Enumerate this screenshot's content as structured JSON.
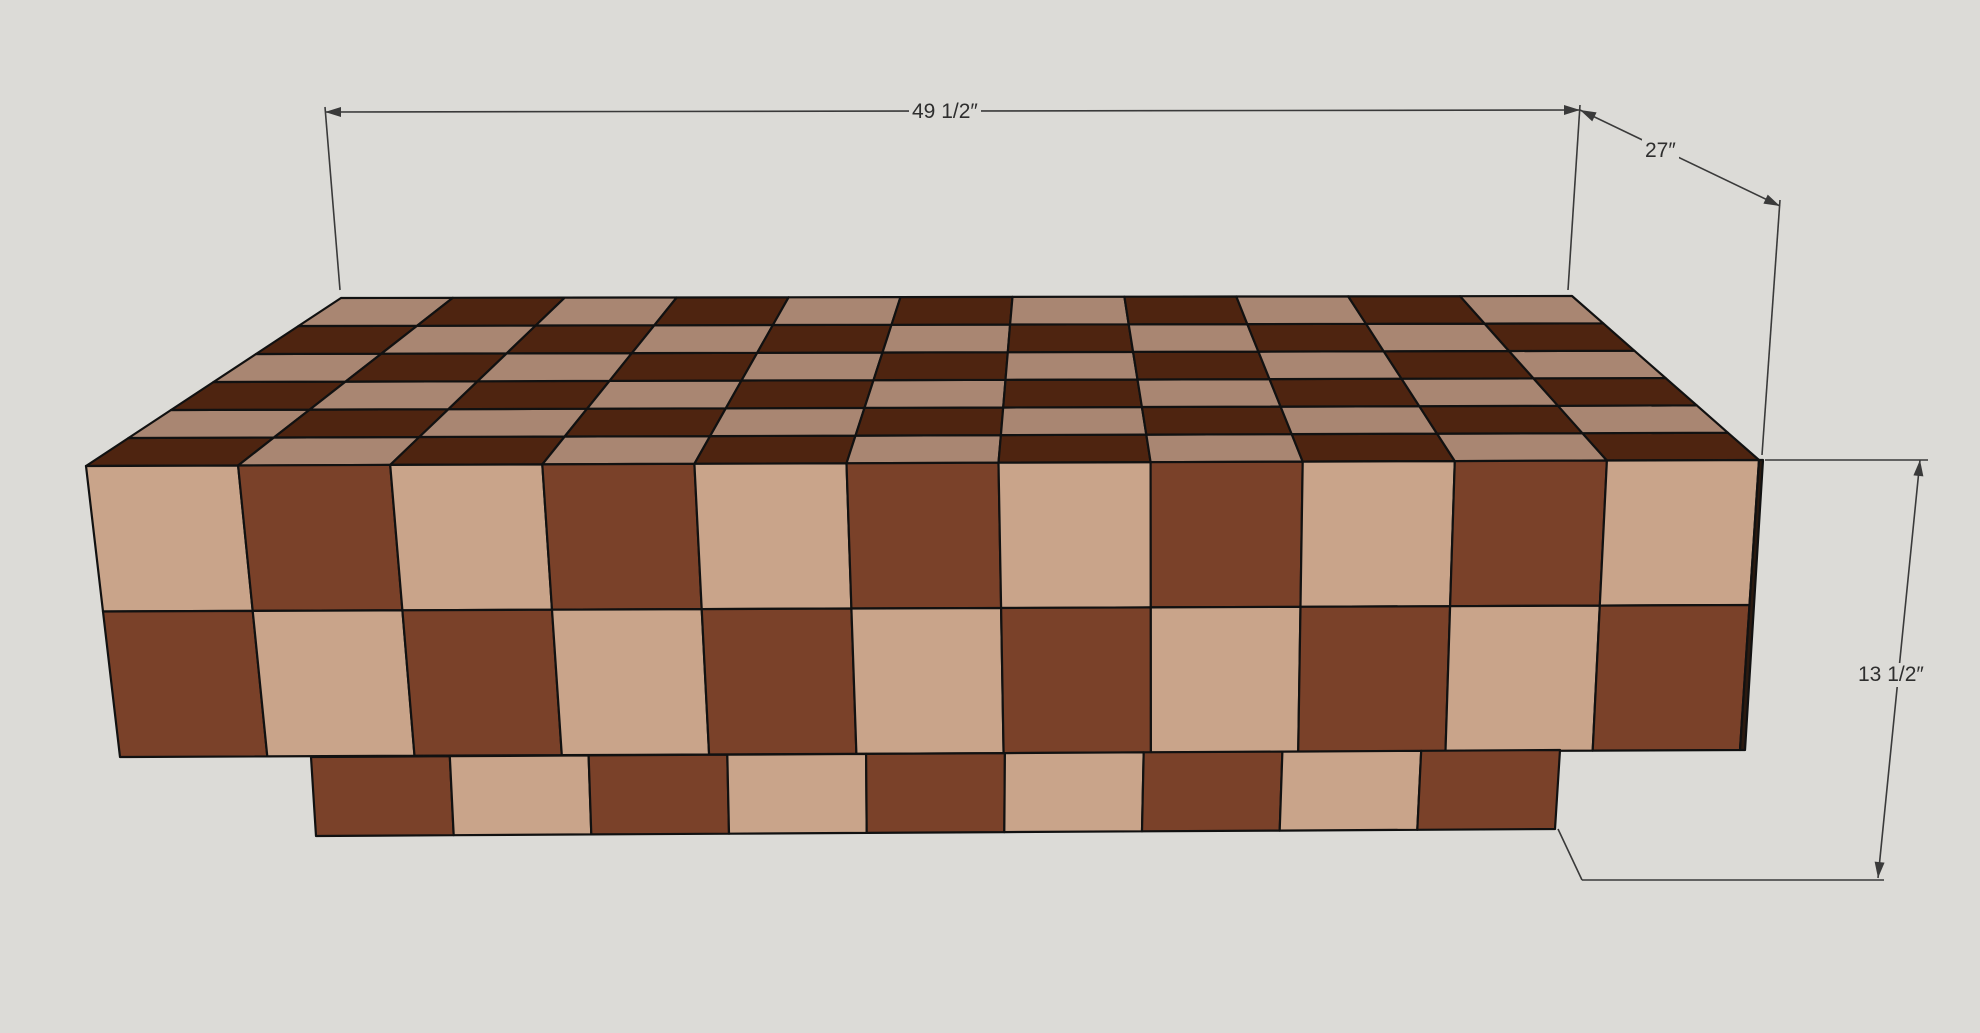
{
  "dimensions": {
    "length": "49 1/2″",
    "depth": "27″",
    "height": "13 1/2″"
  },
  "colors": {
    "background": "#dcdbd7",
    "light_wood": "#c9a48a",
    "dark_wood": "#7a4129",
    "top_light": "#a98672",
    "top_dark": "#4e2410",
    "edge": "#111111",
    "dimension_line": "#3a3a3a"
  },
  "model": {
    "top_columns": 11,
    "top_rows": 6,
    "front_columns": 11,
    "front_rows": 2,
    "base_columns": 9,
    "first_top_front_cell": "dark",
    "first_front_cell": "light",
    "first_base_cell": "dark"
  }
}
